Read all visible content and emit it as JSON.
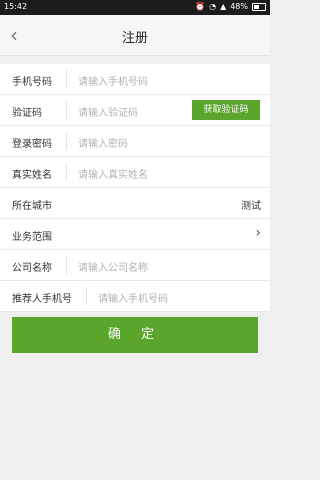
{
  "status_bar": {
    "time": "15:42",
    "battery": "48%"
  },
  "header": {
    "back_icon": "chevron-left-icon",
    "title": "注册"
  },
  "form": {
    "phone": {
      "label": "手机号码",
      "placeholder": "请输入手机号码"
    },
    "code": {
      "label": "验证码",
      "placeholder": "请输入验证码",
      "button": "获取验证码"
    },
    "password": {
      "label": "登录密码",
      "placeholder": "请输入密码"
    },
    "real_name": {
      "label": "真实姓名",
      "placeholder": "请输入真实姓名"
    },
    "city": {
      "label": "所在城市",
      "value": "测试"
    },
    "business_scope": {
      "label": "业务范围"
    },
    "company": {
      "label": "公司名称",
      "placeholder": "请输入公司名称"
    },
    "referrer_phone": {
      "label": "推荐人手机号",
      "placeholder": "请输入手机号码"
    }
  },
  "confirm_button": "确 定",
  "colors": {
    "accent": "#5aa62d",
    "background": "#efefef"
  }
}
